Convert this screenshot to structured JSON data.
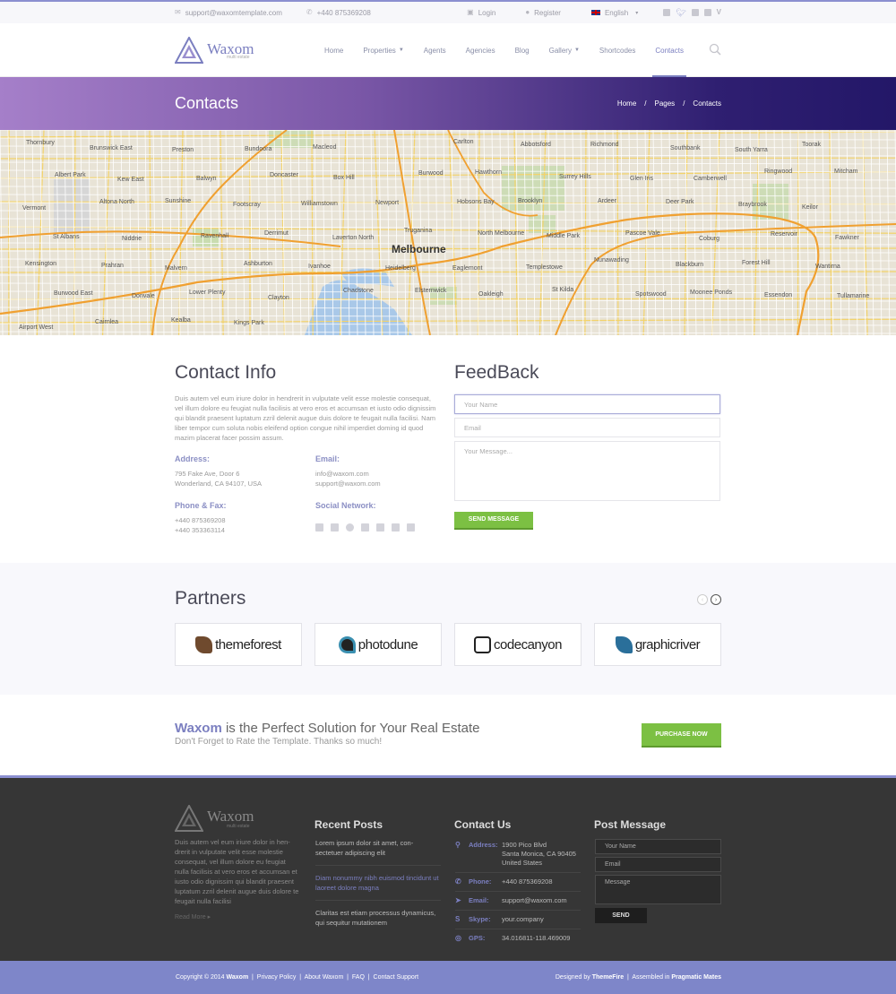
{
  "topbar": {
    "email": "support@waxomtemplate.com",
    "phone": "+440 875369208",
    "login": "Login",
    "register": "Register",
    "language": "English",
    "email_icon": "envelope-icon",
    "phone_icon": "phone-icon"
  },
  "header": {
    "logo_text": "Waxom",
    "logo_tagline": "multi estate",
    "nav": [
      {
        "label": "Home"
      },
      {
        "label": "Properties"
      },
      {
        "label": "Agents"
      },
      {
        "label": "Agencies"
      },
      {
        "label": "Blog"
      },
      {
        "label": "Gallery"
      },
      {
        "label": "Shortcodes"
      },
      {
        "label": "Contacts"
      }
    ],
    "active_nav": "Contacts"
  },
  "page_title": {
    "title": "Contacts",
    "breadcrumbs": [
      "Home",
      "/",
      "Pages",
      "/",
      "Contacts"
    ]
  },
  "map": {
    "labels": [
      "Thornbury",
      "Brunswick East",
      "Preston",
      "Bundoora",
      "Macleod",
      "Melbourne",
      "Carlton",
      "Abbotsford",
      "Richmond",
      "Southbank",
      "South Yarra",
      "Toorak",
      "Albert Park",
      "Kew East",
      "Balwyn",
      "Doncaster",
      "Box Hill",
      "Burwood",
      "Hawthorn",
      "Surrey Hills",
      "Glen Iris",
      "Camberwell",
      "Ringwood",
      "Mitcham",
      "Vermont",
      "Altona North",
      "Sunshine",
      "Footscray",
      "Williamstown",
      "Newport",
      "Hobsons Bay",
      "Brooklyn",
      "Ardeer",
      "Deer Park",
      "Braybrook",
      "Keilor",
      "St Albans",
      "Niddrie",
      "Ravenhall",
      "Derrimut",
      "Laverton North",
      "Truganina",
      "North Melbourne",
      "Middle Park",
      "Pascoe Vale",
      "Coburg",
      "Reservoir",
      "Fawkner",
      "Kensington",
      "Prahran",
      "Malvern",
      "Ashburton",
      "Ivanhoe",
      "Heidelberg",
      "Eaglemont",
      "Templestowe",
      "Nunawading",
      "Blackburn",
      "Forest Hill",
      "Wantirna",
      "Burwood East",
      "Donvale",
      "Lower Plenty",
      "Clayton",
      "Chadstone",
      "Elsternwick",
      "Oakleigh",
      "St Kilda",
      "Spotswood",
      "Moonee Ponds",
      "Essendon",
      "Tullamarine",
      "Airport West",
      "Cairnlea",
      "Kealba",
      "Kings Park"
    ]
  },
  "contact_info": {
    "title": "Contact Info",
    "text": "Duis autem vel eum iriure dolor in hendrerit in vulputate velit esse molestie consequat, vel illum dolore eu feugiat nulla facilisis at vero eros et accumsan et iusto odio dignissim qui blandit praesent luptatum zzril delenit augue duis dolore te feugait nulla facilisi. Nam liber tempor cum soluta nobis eleifend option congue nihil imperdiet doming id quod mazim placerat facer possim assum.",
    "address_label": "Address:",
    "address": [
      "795 Fake Ave, Door 6",
      "Wonderland, CA 94107, USA"
    ],
    "email_label": "Email:",
    "emails": [
      "info@waxom.com",
      "support@waxom.com"
    ],
    "phone_label": "Phone & Fax:",
    "phones": [
      "+440 875369208",
      "+440 353363114"
    ],
    "social_label": "Social Network:",
    "socials": [
      "facebook-icon",
      "twitter-icon",
      "dribbble-icon",
      "google-plus-icon",
      "instagram-icon",
      "vimeo-icon",
      "skype-icon"
    ]
  },
  "feedback": {
    "title": "FeedBack",
    "name_placeholder": "Your Name",
    "email_placeholder": "Email",
    "message_placeholder": "Your Message...",
    "send_label": "SEND MESSAGE",
    "accent": "#7cc043"
  },
  "partners": {
    "title": "Partners",
    "items": [
      {
        "name": "themeforest",
        "color": "#6f4a2e"
      },
      {
        "name": "photodune",
        "color": "#3a8fb0"
      },
      {
        "name": "codecanyon",
        "color": "#222222"
      },
      {
        "name": "graphicriver",
        "color": "#2a6f9a"
      }
    ]
  },
  "cta": {
    "brand": "Waxom",
    "title_rest": " is the Perfect Solution for Your Real Estate",
    "subtitle": "Don't Forget to Rate the Template. Thanks so much!",
    "button": "PURCHASE NOW"
  },
  "footer": {
    "logo_text": "Waxom",
    "logo_tagline": "multi estate",
    "about": "Duis autem vel eum iriure dolor in hen-drerit in vulputate velit esse molestie consequat, vel illum dolore eu feugiat nulla facilisis at vero eros et accumsan et iusto odio dignissim qui blandit praesent luptatum zzril delenit augue duis dolore te feugait nulla facilisi",
    "read_more": "Read More",
    "recent_title": "Recent Posts",
    "posts": [
      "Lorem ipsum dolor sit amet, con-sectetuer adipiscing elit",
      "Diam nonummy nibh euismod tincidunt ut laoreet dolore magna",
      "Claritas est etiam processus dynamicus, qui sequitur mutationem"
    ],
    "contact_title": "Contact Us",
    "contact": {
      "address_label": "Address:",
      "address": [
        "1900 Pico Blvd",
        "Santa Monica, CA 90405",
        "United States"
      ],
      "phone_label": "Phone:",
      "phone": "+440 875369208",
      "email_label": "Email:",
      "email": "support@waxom.com",
      "skype_label": "Skype:",
      "skype": "your.company",
      "gps_label": "GPS:",
      "gps": "34.016811-118.469009"
    },
    "post_title": "Post Message",
    "name_placeholder": "Your Name",
    "email_placeholder": "Email",
    "message_placeholder": "Message",
    "send": "SEND"
  },
  "bottombar": {
    "copyright_pre": "Copyright © 2014",
    "copyright_brand": "Waxom",
    "links": [
      "Privacy Policy",
      "About Waxom",
      "FAQ",
      "Contact Support"
    ],
    "designed_pre": "Designed by",
    "designed_by": "ThemeFire",
    "assembled_pre": "Assembled in",
    "assembled_by": "Pragmatic Mates"
  }
}
